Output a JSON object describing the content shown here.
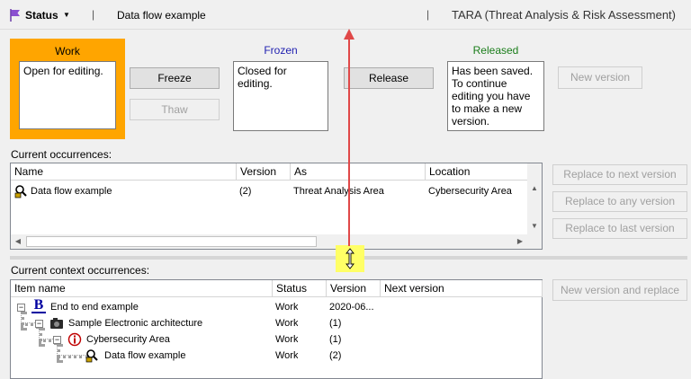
{
  "header": {
    "status_label": "Status",
    "separator": "|",
    "title": "Data flow example",
    "app_title": "TARA (Threat Analysis & Risk Assessment)",
    "app_separator": "|"
  },
  "states": {
    "work": {
      "title": "Work",
      "text": "Open for editing."
    },
    "frozen": {
      "title": "Frozen",
      "text": "Closed for editing."
    },
    "released": {
      "title": "Released",
      "text": "Has been saved. To continue editing you have to make a new version."
    }
  },
  "buttons": {
    "freeze": "Freeze",
    "thaw": "Thaw",
    "release": "Release",
    "new_version": "New version",
    "replace_next": "Replace to next version",
    "replace_any": "Replace to any version",
    "replace_last": "Replace to last version",
    "new_version_replace": "New version and replace"
  },
  "current_occurrences": {
    "label": "Current occurrences:",
    "columns": [
      "Name",
      "Version",
      "As",
      "Location"
    ],
    "rows": [
      {
        "name": "Data flow example",
        "version": "(2)",
        "as": "Threat Analysis Area",
        "location": "Cybersecurity Area"
      }
    ]
  },
  "context_occurrences": {
    "label": "Current context occurrences:",
    "columns": [
      "Item name",
      "Status",
      "Version",
      "Next version"
    ],
    "rows": [
      {
        "name": "End to end example",
        "status": "Work",
        "version": "2020-06...",
        "next": "",
        "icon": "b-icon"
      },
      {
        "name": "Sample Electronic architecture",
        "status": "Work",
        "version": "(1)",
        "next": "",
        "icon": "camera-icon"
      },
      {
        "name": "Cybersecurity Area",
        "status": "Work",
        "version": "(1)",
        "next": "",
        "icon": "info-circle-icon"
      },
      {
        "name": "Data flow example",
        "status": "Work",
        "version": "(2)",
        "next": "",
        "icon": "dataflow-lock-icon"
      }
    ]
  },
  "colors": {
    "work_bg": "#ffa500",
    "frozen_title": "#1f1fb0",
    "released_title": "#1a7d1a",
    "annotation_red": "#e04848",
    "splitter_highlight": "#ffff66"
  }
}
